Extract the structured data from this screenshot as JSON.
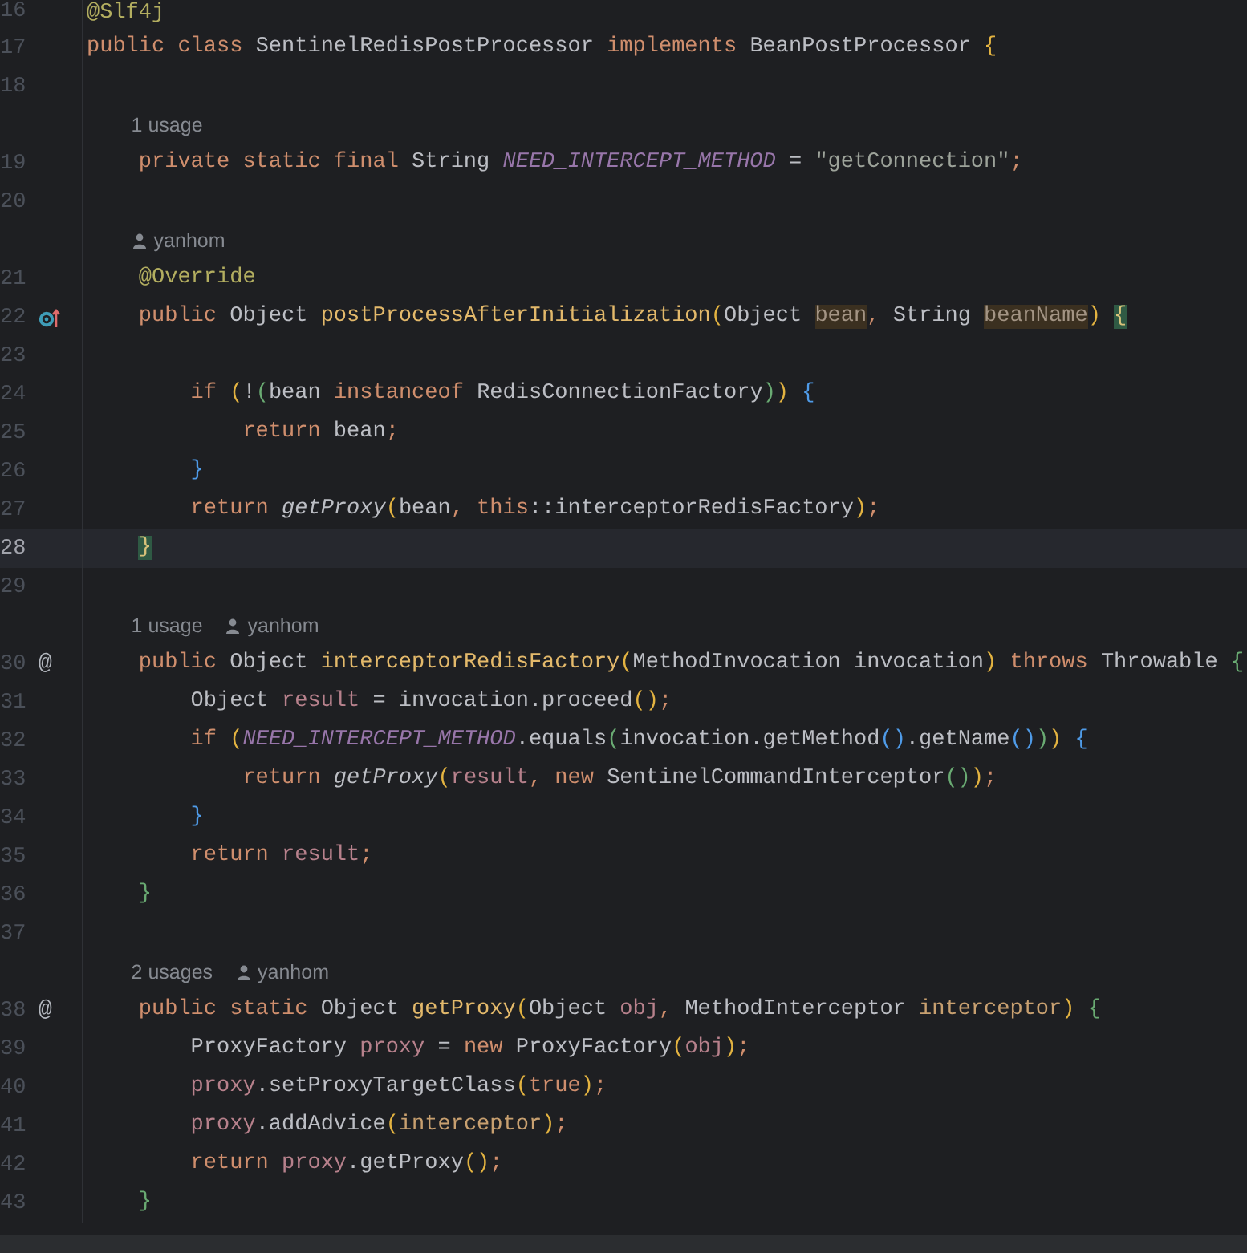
{
  "editor": {
    "lines": [
      {
        "kind": "code",
        "number": "16",
        "tokens": [
          {
            "text": "@Slf4j",
            "kind": "annotation"
          }
        ]
      },
      {
        "kind": "code",
        "number": "17",
        "tokens": [
          {
            "text": "public class ",
            "kind": "keyword"
          },
          {
            "text": "SentinelRedisPostProcessor ",
            "kind": "plain"
          },
          {
            "text": "implements ",
            "kind": "keyword"
          },
          {
            "text": "BeanPostProcessor ",
            "kind": "plain"
          },
          {
            "text": "{",
            "kind": "bracket1"
          }
        ]
      },
      {
        "kind": "code",
        "number": "18"
      },
      {
        "kind": "hint",
        "items": [
          {
            "kind": "usages",
            "text": "1 usage"
          }
        ]
      },
      {
        "kind": "code",
        "number": "19",
        "tokens": [
          {
            "text": "    private static final ",
            "kind": "keyword"
          },
          {
            "text": "String ",
            "kind": "plain"
          },
          {
            "text": "NEED_INTERCEPT_METHOD",
            "kind": "constant"
          },
          {
            "text": " = ",
            "kind": "plain"
          },
          {
            "text": "\"getConnection\"",
            "kind": "string"
          },
          {
            "text": ";",
            "kind": "punct"
          }
        ]
      },
      {
        "kind": "code",
        "number": "20"
      },
      {
        "kind": "hint",
        "items": [
          {
            "kind": "author",
            "text": "yanhom"
          }
        ]
      },
      {
        "kind": "code",
        "number": "21",
        "tokens": [
          {
            "text": "    @Override",
            "kind": "annotation"
          }
        ]
      },
      {
        "kind": "code",
        "number": "22",
        "gutter": {
          "kind": "override"
        },
        "tokens": [
          {
            "text": "    public ",
            "kind": "keyword"
          },
          {
            "text": "Object ",
            "kind": "plain"
          },
          {
            "text": "postProcessAfterInitialization",
            "kind": "method"
          },
          {
            "text": "(",
            "kind": "bracket1"
          },
          {
            "text": "Object ",
            "kind": "plain"
          },
          {
            "text": "bean",
            "kind": "param_highlight"
          },
          {
            "text": ", ",
            "kind": "punct"
          },
          {
            "text": "String ",
            "kind": "plain"
          },
          {
            "text": "beanName",
            "kind": "param_highlight"
          },
          {
            "text": ") ",
            "kind": "bracket1"
          },
          {
            "text": "{",
            "kind": "brace_match"
          }
        ]
      },
      {
        "kind": "code",
        "number": "23"
      },
      {
        "kind": "code",
        "number": "24",
        "tokens": [
          {
            "text": "        if ",
            "kind": "keyword"
          },
          {
            "text": "(",
            "kind": "bracket1"
          },
          {
            "text": "!",
            "kind": "plain"
          },
          {
            "text": "(",
            "kind": "bracket2"
          },
          {
            "text": "bean ",
            "kind": "plain"
          },
          {
            "text": "instanceof ",
            "kind": "keyword"
          },
          {
            "text": "RedisConnectionFactory",
            "kind": "plain"
          },
          {
            "text": ")",
            "kind": "bracket2"
          },
          {
            "text": ") ",
            "kind": "bracket1"
          },
          {
            "text": "{",
            "kind": "bracket3"
          }
        ]
      },
      {
        "kind": "code",
        "number": "25",
        "tokens": [
          {
            "text": "            return ",
            "kind": "keyword"
          },
          {
            "text": "bean",
            "kind": "plain"
          },
          {
            "text": ";",
            "kind": "punct"
          }
        ]
      },
      {
        "kind": "code",
        "number": "26",
        "tokens": [
          {
            "text": "        }",
            "kind": "bracket3"
          }
        ]
      },
      {
        "kind": "code",
        "number": "27",
        "tokens": [
          {
            "text": "        return ",
            "kind": "keyword"
          },
          {
            "text": "getProxy",
            "kind": "static_call"
          },
          {
            "text": "(",
            "kind": "bracket1"
          },
          {
            "text": "bean",
            "kind": "plain"
          },
          {
            "text": ", ",
            "kind": "punct"
          },
          {
            "text": "this",
            "kind": "keyword"
          },
          {
            "text": "::interceptorRedisFactory",
            "kind": "plain"
          },
          {
            "text": ")",
            "kind": "bracket1"
          },
          {
            "text": ";",
            "kind": "punct"
          }
        ]
      },
      {
        "kind": "code",
        "number": "28",
        "current": true,
        "tokens": [
          {
            "text": "    }",
            "kind": "brace_match"
          }
        ]
      },
      {
        "kind": "code",
        "number": "29"
      },
      {
        "kind": "hint",
        "items": [
          {
            "kind": "usages",
            "text": "1 usage"
          },
          {
            "kind": "author",
            "text": "yanhom"
          }
        ]
      },
      {
        "kind": "code",
        "number": "30",
        "gutter_mark": "@",
        "tokens": [
          {
            "text": "    public ",
            "kind": "keyword"
          },
          {
            "text": "Object ",
            "kind": "plain"
          },
          {
            "text": "interceptorRedisFactory",
            "kind": "method"
          },
          {
            "text": "(",
            "kind": "bracket1"
          },
          {
            "text": "MethodInvocation invocation",
            "kind": "plain"
          },
          {
            "text": ")",
            "kind": "bracket1"
          },
          {
            "text": " throws ",
            "kind": "keyword"
          },
          {
            "text": "Throwable ",
            "kind": "plain"
          },
          {
            "text": "{",
            "kind": "bracket2"
          }
        ]
      },
      {
        "kind": "code",
        "number": "31",
        "tokens": [
          {
            "text": "        Object ",
            "kind": "plain"
          },
          {
            "text": "result",
            "kind": "local"
          },
          {
            "text": " = invocation.proceed",
            "kind": "plain"
          },
          {
            "text": "()",
            "kind": "bracket1"
          },
          {
            "text": ";",
            "kind": "punct"
          }
        ]
      },
      {
        "kind": "code",
        "number": "32",
        "tokens": [
          {
            "text": "        if ",
            "kind": "keyword"
          },
          {
            "text": "(",
            "kind": "bracket1"
          },
          {
            "text": "NEED_INTERCEPT_METHOD",
            "kind": "constant"
          },
          {
            "text": ".equals",
            "kind": "plain"
          },
          {
            "text": "(",
            "kind": "bracket2"
          },
          {
            "text": "invocation.getMethod",
            "kind": "plain"
          },
          {
            "text": "()",
            "kind": "bracket3"
          },
          {
            "text": ".getName",
            "kind": "plain"
          },
          {
            "text": "()",
            "kind": "bracket3"
          },
          {
            "text": ")",
            "kind": "bracket2"
          },
          {
            "text": ") ",
            "kind": "bracket1"
          },
          {
            "text": "{",
            "kind": "bracket3"
          }
        ]
      },
      {
        "kind": "code",
        "number": "33",
        "tokens": [
          {
            "text": "            return ",
            "kind": "keyword"
          },
          {
            "text": "getProxy",
            "kind": "static_call"
          },
          {
            "text": "(",
            "kind": "bracket1"
          },
          {
            "text": "result",
            "kind": "local"
          },
          {
            "text": ", ",
            "kind": "punct"
          },
          {
            "text": "new ",
            "kind": "keyword"
          },
          {
            "text": "SentinelCommandInterceptor",
            "kind": "plain"
          },
          {
            "text": "()",
            "kind": "bracket2"
          },
          {
            "text": ")",
            "kind": "bracket1"
          },
          {
            "text": ";",
            "kind": "punct"
          }
        ]
      },
      {
        "kind": "code",
        "number": "34",
        "tokens": [
          {
            "text": "        }",
            "kind": "bracket3"
          }
        ]
      },
      {
        "kind": "code",
        "number": "35",
        "tokens": [
          {
            "text": "        return ",
            "kind": "keyword"
          },
          {
            "text": "result",
            "kind": "local"
          },
          {
            "text": ";",
            "kind": "punct"
          }
        ]
      },
      {
        "kind": "code",
        "number": "36",
        "tokens": [
          {
            "text": "    }",
            "kind": "bracket2"
          }
        ]
      },
      {
        "kind": "code",
        "number": "37"
      },
      {
        "kind": "hint",
        "items": [
          {
            "kind": "usages",
            "text": "2 usages"
          },
          {
            "kind": "author",
            "text": "yanhom"
          }
        ]
      },
      {
        "kind": "code",
        "number": "38",
        "gutter_mark": "@",
        "tokens": [
          {
            "text": "    public static ",
            "kind": "keyword"
          },
          {
            "text": "Object ",
            "kind": "plain"
          },
          {
            "text": "getProxy",
            "kind": "method"
          },
          {
            "text": "(",
            "kind": "bracket1"
          },
          {
            "text": "Object ",
            "kind": "plain"
          },
          {
            "text": "obj",
            "kind": "local"
          },
          {
            "text": ", ",
            "kind": "punct"
          },
          {
            "text": "MethodInterceptor ",
            "kind": "plain"
          },
          {
            "text": "interceptor",
            "kind": "param"
          },
          {
            "text": ") ",
            "kind": "bracket1"
          },
          {
            "text": "{",
            "kind": "bracket2"
          }
        ]
      },
      {
        "kind": "code",
        "number": "39",
        "tokens": [
          {
            "text": "        ProxyFactory ",
            "kind": "plain"
          },
          {
            "text": "proxy",
            "kind": "local"
          },
          {
            "text": " = ",
            "kind": "plain"
          },
          {
            "text": "new ",
            "kind": "keyword"
          },
          {
            "text": "ProxyFactory",
            "kind": "plain"
          },
          {
            "text": "(",
            "kind": "bracket1"
          },
          {
            "text": "obj",
            "kind": "local"
          },
          {
            "text": ")",
            "kind": "bracket1"
          },
          {
            "text": ";",
            "kind": "punct"
          }
        ]
      },
      {
        "kind": "code",
        "number": "40",
        "tokens": [
          {
            "text": "        proxy",
            "kind": "local"
          },
          {
            "text": ".setProxyTargetClass",
            "kind": "plain"
          },
          {
            "text": "(",
            "kind": "bracket1"
          },
          {
            "text": "true",
            "kind": "keyword"
          },
          {
            "text": ")",
            "kind": "bracket1"
          },
          {
            "text": ";",
            "kind": "punct"
          }
        ]
      },
      {
        "kind": "code",
        "number": "41",
        "tokens": [
          {
            "text": "        proxy",
            "kind": "local"
          },
          {
            "text": ".addAdvice",
            "kind": "plain"
          },
          {
            "text": "(",
            "kind": "bracket1"
          },
          {
            "text": "interceptor",
            "kind": "param"
          },
          {
            "text": ")",
            "kind": "bracket1"
          },
          {
            "text": ";",
            "kind": "punct"
          }
        ]
      },
      {
        "kind": "code",
        "number": "42",
        "tokens": [
          {
            "text": "        return ",
            "kind": "keyword"
          },
          {
            "text": "proxy",
            "kind": "local"
          },
          {
            "text": ".getProxy",
            "kind": "plain"
          },
          {
            "text": "()",
            "kind": "bracket1"
          },
          {
            "text": ";",
            "kind": "punct"
          }
        ]
      },
      {
        "kind": "code",
        "number": "43",
        "tokens": [
          {
            "text": "    }",
            "kind": "bracket2"
          }
        ]
      }
    ]
  }
}
